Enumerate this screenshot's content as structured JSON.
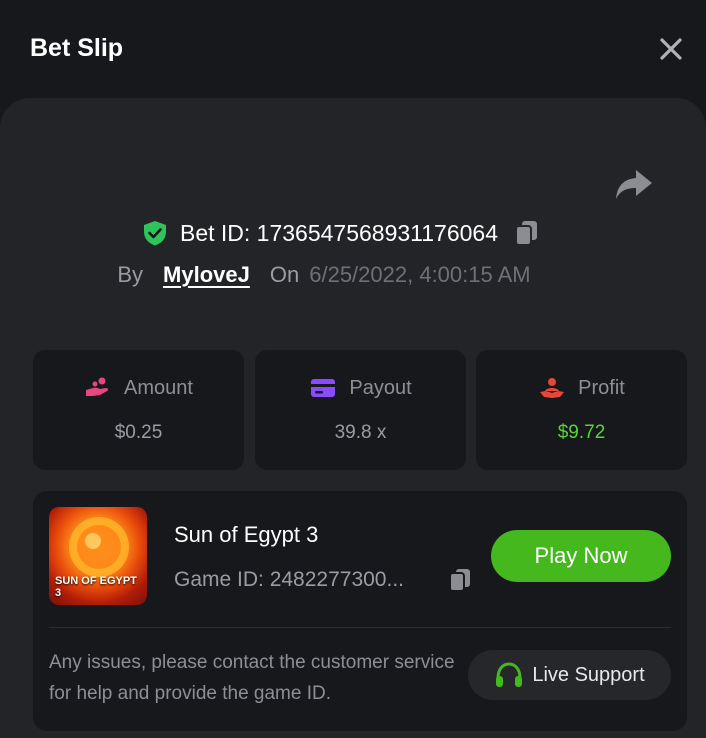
{
  "header": {
    "title": "Bet Slip"
  },
  "bet": {
    "id_label": "Bet ID: 1736547568931176064",
    "by_label": "By",
    "username": "MyloveJ",
    "on_label": "On",
    "datetime": "6/25/2022, 4:00:15 AM"
  },
  "stats": [
    {
      "label": "Amount",
      "value": "$0.25",
      "icon": "coins-hand-icon",
      "color": "#e8467c"
    },
    {
      "label": "Payout",
      "value": "39.8 x",
      "icon": "card-icon",
      "color": "#8a4bff"
    },
    {
      "label": "Profit",
      "value": "$9.72",
      "icon": "profit-hand-icon",
      "color": "#e8463a"
    }
  ],
  "game": {
    "name": "Sun of Egypt 3",
    "id_label": "Game ID: 2482277300...",
    "thumb_text": "SUN OF EGYPT 3",
    "play_label": "Play Now"
  },
  "support": {
    "message": "Any issues, please contact the customer service for help and provide the game ID.",
    "button_label": "Live Support"
  },
  "colors": {
    "accent_green": "#45b81d",
    "profit_green": "#5bd23a",
    "shield_green": "#2fc35a",
    "background": "#17181b",
    "panel": "#232427"
  }
}
